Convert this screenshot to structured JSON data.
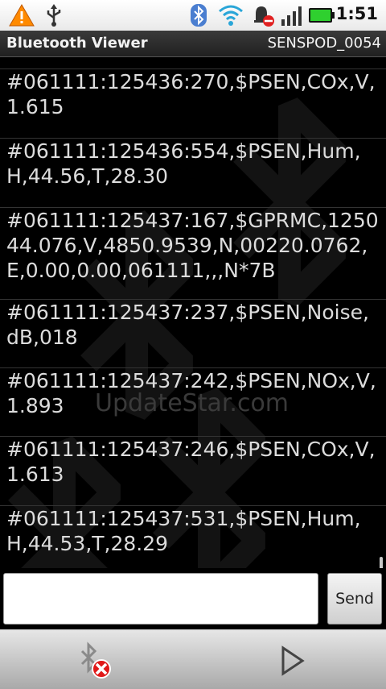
{
  "status_bar": {
    "time": "1:51",
    "icons": [
      "warning-icon",
      "usb-icon",
      "bluetooth-icon",
      "wifi-icon",
      "alarm-off-icon",
      "signal-icon",
      "battery-icon"
    ],
    "battery_color": "#2fd02f",
    "warning_color": "#ff8a00"
  },
  "title_bar": {
    "app_title": "Bluetooth Viewer",
    "device_name": "SENSPOD_0054"
  },
  "messages": [
    "#061111:125436:270,$PSEN,COx,V,1.615",
    "#061111:125436:554,$PSEN,Hum,H,44.56,T,28.30",
    "#061111:125437:167,$GPRMC,125044.076,V,4850.9539,N,00220.0762,E,0.00,0.00,061111,,,N*7B",
    "#061111:125437:237,$PSEN,Noise,dB,018",
    "#061111:125437:242,$PSEN,NOx,V,1.893",
    "#061111:125437:246,$PSEN,COx,V,1.613",
    "#061111:125437:531,$PSEN,Hum,H,44.53,T,28.29"
  ],
  "watermark": "UpdateStar.com",
  "input": {
    "value": "",
    "placeholder": ""
  },
  "send_label": "Send",
  "bottom_bar": {
    "disconnect_icon": "bluetooth-disconnect-icon",
    "play_icon": "play-icon"
  }
}
